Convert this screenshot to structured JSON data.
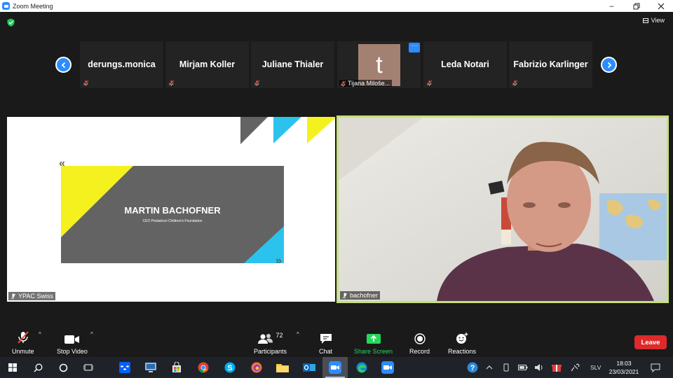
{
  "window": {
    "title": "Zoom Meeting"
  },
  "top_bar": {
    "view_label": "View"
  },
  "participants_strip": [
    {
      "name": "derungs.monica",
      "muted": true
    },
    {
      "name": "Mirjam Koller",
      "muted": true
    },
    {
      "name": "Juliane Thialer",
      "muted": true
    },
    {
      "name": "Tijana Miloše...",
      "avatar_letter": "t",
      "muted": true,
      "more": "···"
    },
    {
      "name": "Leda Notari",
      "muted": true
    },
    {
      "name": "Fabrizio Karlinger",
      "muted": true
    }
  ],
  "shared_screen": {
    "owner": "YPAC Swiss",
    "slide_title": "MARTIN BACHOFNER",
    "slide_subtitle": "CEO Pestalozzi Children's Foundation",
    "quote_open": "«",
    "quote_close": "»"
  },
  "active_speaker": {
    "name": "bachofner"
  },
  "toolbar": {
    "unmute": "Unmute",
    "stop_video": "Stop Video",
    "participants": "Participants",
    "participants_count": "72",
    "chat": "Chat",
    "share_screen": "Share Screen",
    "record": "Record",
    "reactions": "Reactions",
    "leave": "Leave"
  },
  "taskbar": {
    "language": "SLV",
    "time": "18:03",
    "date": "23/03/2021"
  },
  "colors": {
    "zoom_blue": "#2d8cff",
    "share_green": "#23d959",
    "leave_red": "#dd2b2b",
    "speaker_border": "#c5e07a",
    "slide_yellow": "#f4f11f",
    "slide_cyan": "#2bc3ee",
    "slide_gray": "#636363"
  }
}
